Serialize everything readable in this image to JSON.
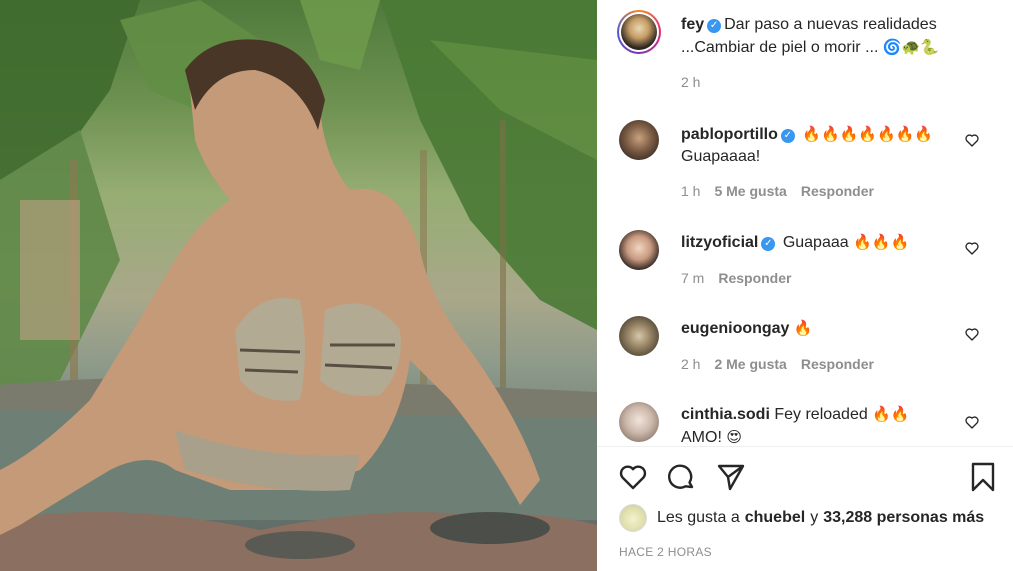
{
  "post": {
    "image_alt": "",
    "author": {
      "username": "fey",
      "verified": true,
      "caption_line1": "Dar paso a nuevas realidades",
      "caption_line2": "...Cambiar de piel o morir ...",
      "caption_emojis": "🌀🐢🐍",
      "time": "2 h"
    },
    "comments": [
      {
        "username": "pabloportillo",
        "verified": true,
        "text_emojis": "🔥🔥🔥🔥🔥🔥🔥",
        "text": "Guapaaaa!",
        "time": "1 h",
        "likes": "5 Me gusta",
        "reply": "Responder"
      },
      {
        "username": "litzyoficial",
        "verified": true,
        "text": "Guapaaa",
        "text_emojis": "🔥🔥🔥",
        "time": "7 m",
        "reply": "Responder"
      },
      {
        "username": "eugenioongay",
        "verified": false,
        "text_emojis": "🔥",
        "time": "2 h",
        "likes": "2 Me gusta",
        "reply": "Responder"
      },
      {
        "username": "cinthia.sodi",
        "verified": false,
        "text": "Fey reloaded",
        "text_emojis": "🔥🔥",
        "text_line2": "AMO!",
        "text_line2_emoji": "😍"
      }
    ],
    "actions": {
      "like_icon": "heart-icon",
      "comment_icon": "comment-bubble-icon",
      "share_icon": "paper-plane-icon",
      "save_icon": "bookmark-icon"
    },
    "liked_by": {
      "prefix": "Les gusta a",
      "user": "chuebel",
      "connector": "y",
      "count_text": "33,288 personas más"
    },
    "timestamp": "HACE 2 HORAS"
  },
  "colors": {
    "text": "#262626",
    "muted": "#8e8e8e",
    "verified": "#3897f0",
    "divider": "#efefef"
  }
}
